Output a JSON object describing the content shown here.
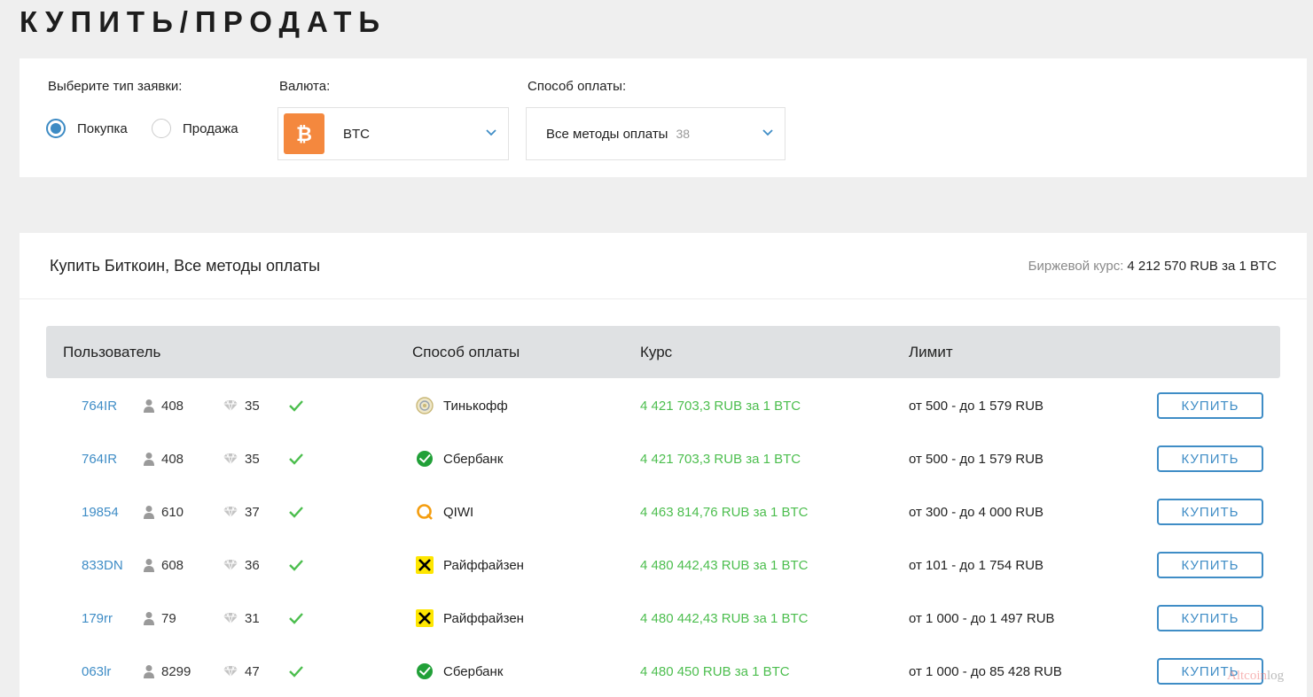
{
  "page": {
    "title": "КУПИТЬ/ПРОДАТЬ"
  },
  "filters": {
    "type_label": "Выберите тип заявки:",
    "type_options": [
      {
        "label": "Покупка",
        "checked": true
      },
      {
        "label": "Продажа",
        "checked": false
      }
    ],
    "currency_label": "Валюта:",
    "currency_value": "BTC",
    "payment_label": "Способ оплаты:",
    "payment_value": "Все методы оплаты",
    "payment_count": "38"
  },
  "offers": {
    "title": "Купить Биткоин, Все методы оплаты",
    "rate_label": "Биржевой курс:",
    "rate_value": "4 212 570 RUB за 1 BTC",
    "columns": [
      "Пользователь",
      "Способ оплаты",
      "Курс",
      "Лимит"
    ],
    "buy_label": "КУПИТЬ",
    "rows": [
      {
        "user": "764IR",
        "deals": "408",
        "rating": "35",
        "verified": true,
        "method": "Тинькофф",
        "method_icon": "tinkoff-icon",
        "price": "4 421 703,3 RUB за 1 BTC",
        "limit": "от 500 - до 1 579 RUB"
      },
      {
        "user": "764IR",
        "deals": "408",
        "rating": "35",
        "verified": true,
        "method": "Сбербанк",
        "method_icon": "sberbank-icon",
        "price": "4 421 703,3 RUB за 1 BTC",
        "limit": "от 500 - до 1 579 RUB"
      },
      {
        "user": "19854",
        "deals": "610",
        "rating": "37",
        "verified": true,
        "method": "QIWI",
        "method_icon": "qiwi-icon",
        "price": "4 463 814,76 RUB за 1 BTC",
        "limit": "от 300 - до 4 000 RUB"
      },
      {
        "user": "833DN",
        "deals": "608",
        "rating": "36",
        "verified": true,
        "method": "Райффайзен",
        "method_icon": "raiffeisen-icon",
        "price": "4 480 442,43 RUB за 1 BTC",
        "limit": "от 101 - до 1 754 RUB"
      },
      {
        "user": "179rr",
        "deals": "79",
        "rating": "31",
        "verified": true,
        "method": "Райффайзен",
        "method_icon": "raiffeisen-icon",
        "price": "4 480 442,43 RUB за 1 BTC",
        "limit": "от 1 000 - до 1 497 RUB"
      },
      {
        "user": "063lr",
        "deals": "8299",
        "rating": "47",
        "verified": true,
        "method": "Сбербанк",
        "method_icon": "sberbank-icon",
        "price": "4 480 450 RUB за 1 BTC",
        "limit": "от 1 000 - до 85 428 RUB"
      }
    ]
  },
  "watermark": {
    "part1": "Altcoin",
    "part2": "log"
  },
  "colors": {
    "accent": "#3f8dc6",
    "price": "#4cbe4e",
    "btc": "#f4883e",
    "header_bg": "#dfe1e3"
  }
}
